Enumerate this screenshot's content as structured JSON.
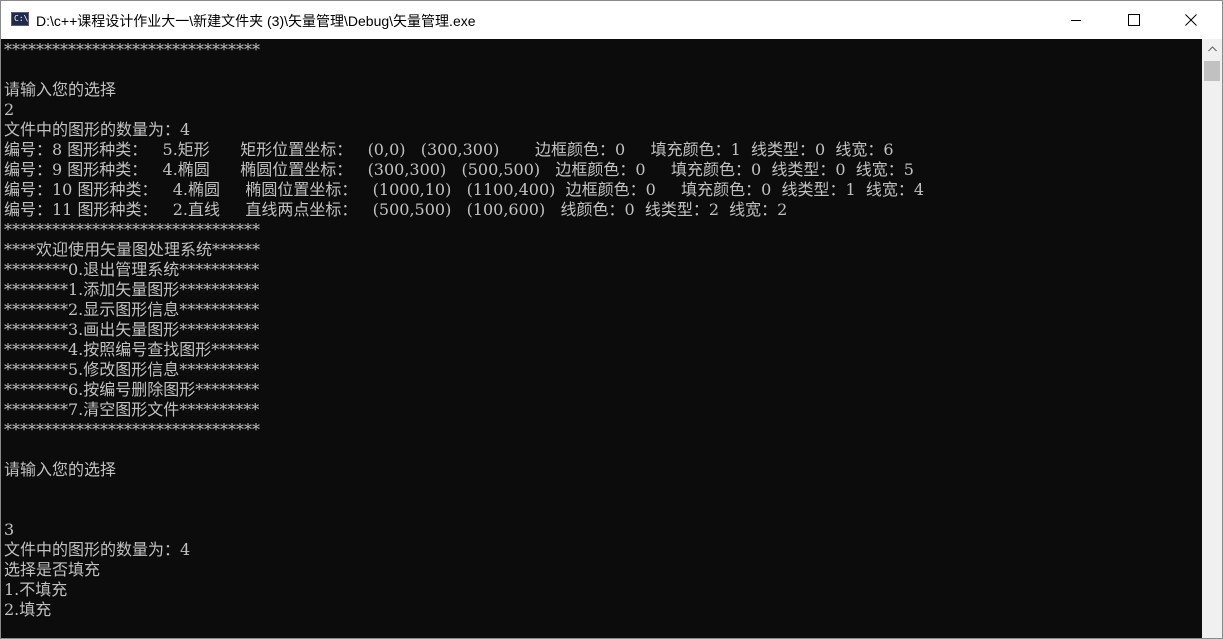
{
  "window": {
    "title": "D:\\c++课程设计作业大一\\新建文件夹 (3)\\矢量管理\\Debug\\矢量管理.exe",
    "app_icon_text": "C:\\"
  },
  "console": {
    "lines": [
      "********************************",
      "",
      "请输入您的选择",
      "2",
      "文件中的图形的数量为：4",
      "编号：8 图形种类：   5.矩形      矩形位置坐标：   (0,0)   (300,300)       边框颜色：0     填充颜色：1  线类型：0  线宽：6",
      "编号：9 图形种类：   4.椭圆      椭圆位置坐标：   (300,300)   (500,500)   边框颜色：0     填充颜色：0  线类型：0  线宽：5",
      "编号：10 图形种类：   4.椭圆     椭圆位置坐标：   (1000,10)   (1100,400)  边框颜色：0     填充颜色：0  线类型：1  线宽：4",
      "编号：11 图形种类：   2.直线     直线两点坐标：   (500,500)   (100,600)   线颜色：0  线类型：2  线宽：2",
      "********************************",
      "****欢迎使用矢量图处理系统******",
      "********0.退出管理系统**********",
      "********1.添加矢量图形**********",
      "********2.显示图形信息**********",
      "********3.画出矢量图形**********",
      "********4.按照编号查找图形******",
      "********5.修改图形信息**********",
      "********6.按编号删除图形********",
      "********7.清空图形文件**********",
      "********************************",
      "",
      "请输入您的选择",
      "",
      "",
      "3",
      "文件中的图形的数量为：4",
      "选择是否填充",
      "1.不填充",
      "2.填充"
    ]
  },
  "colors": {
    "console_bg": "#0c0c0c",
    "console_text": "#c0c0c0"
  }
}
